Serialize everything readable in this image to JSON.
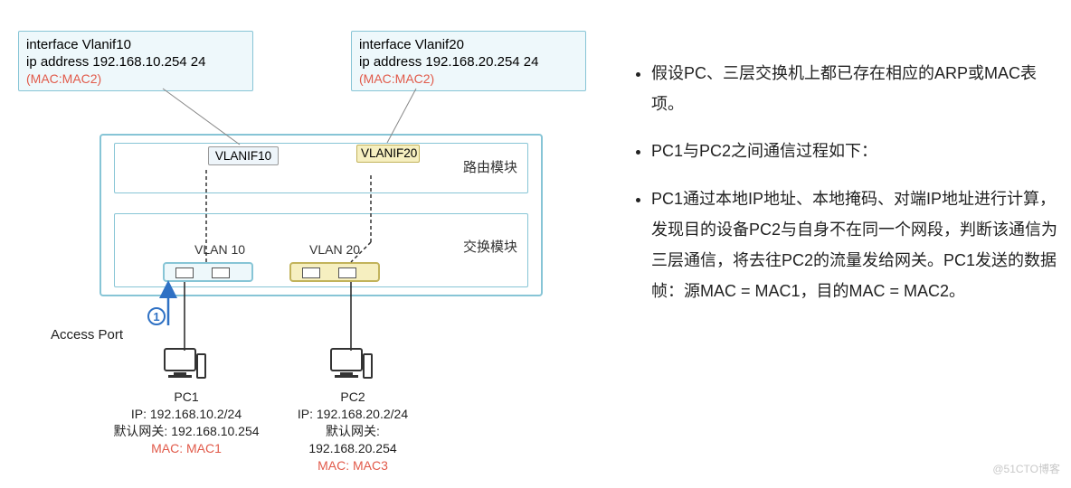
{
  "config": {
    "vlanif10": {
      "line1": "interface Vlanif10",
      "line2": " ip address 192.168.10.254 24",
      "mac": "(MAC:MAC2)"
    },
    "vlanif20": {
      "line1": "interface Vlanif20",
      "line2": " ip address 192.168.20.254 24",
      "mac": "(MAC:MAC2)"
    }
  },
  "switch": {
    "routing_module": "路由模块",
    "switching_module": "交换模块",
    "vlanif10": "VLANIF10",
    "vlanif20": "VLANIF20",
    "vlan10": "VLAN 10",
    "vlan20": "VLAN 20"
  },
  "step": {
    "num": "1",
    "label": "Access Port"
  },
  "pc1": {
    "name": "PC1",
    "ip": "IP: 192.168.10.2/24",
    "gw": "默认网关: 192.168.10.254",
    "mac": "MAC: MAC1"
  },
  "pc2": {
    "name": "PC2",
    "ip": "IP: 192.168.20.2/24",
    "gw1": "默认网关:",
    "gw2": "192.168.20.254",
    "mac": "MAC: MAC3"
  },
  "bullets": {
    "b1": "假设PC、三层交换机上都已存在相应的ARP或MAC表项。",
    "b2": "PC1与PC2之间通信过程如下：",
    "b3": "PC1通过本地IP地址、本地掩码、对端IP地址进行计算，发现目的设备PC2与自身不在同一个网段，判断该通信为三层通信，将去往PC2的流量发给网关。PC1发送的数据帧：源MAC = MAC1，目的MAC = MAC2。"
  },
  "watermark": "@51CTO博客"
}
